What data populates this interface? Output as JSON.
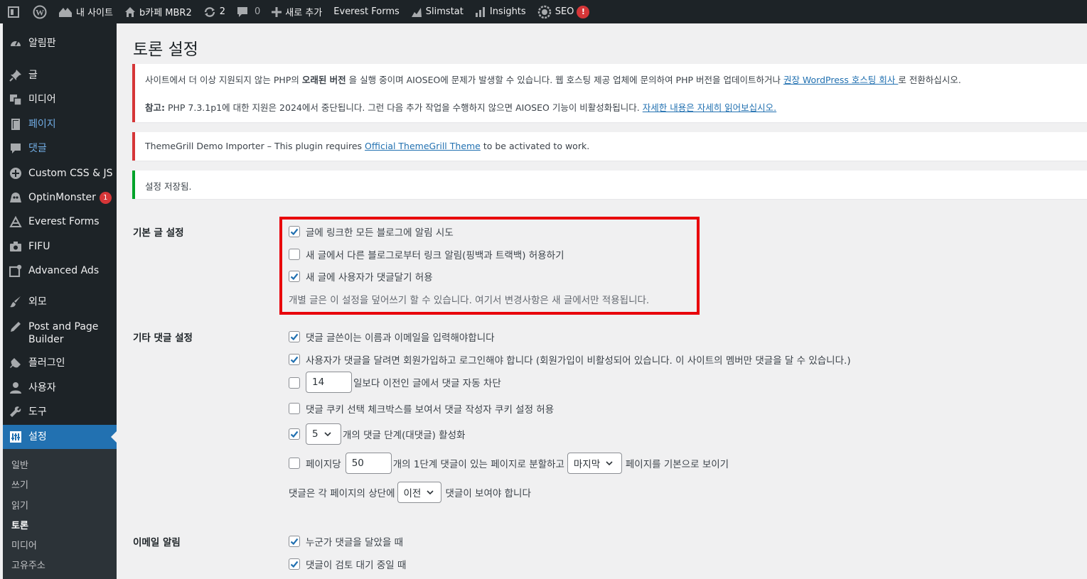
{
  "adminbar": {
    "items": [
      {
        "icon": "wp-logo-icon",
        "label": ""
      },
      {
        "icon": "home-icon",
        "label": "내 사이트"
      },
      {
        "icon": "house-icon",
        "label": "b카페 MBR2"
      },
      {
        "icon": "updates-icon",
        "label": "2"
      },
      {
        "icon": "comment-icon",
        "label": "0"
      },
      {
        "icon": "plus-icon",
        "label": "새로 추가"
      },
      {
        "icon": "",
        "label": "Everest Forms"
      },
      {
        "icon": "chart-icon",
        "label": "Slimstat"
      },
      {
        "icon": "bar-chart-icon",
        "label": "Insights"
      },
      {
        "icon": "seo-gear-icon",
        "label": "SEO",
        "badge": "!"
      }
    ]
  },
  "sidebar": {
    "items": [
      {
        "icon": "dashboard-icon",
        "label": "알림판"
      },
      {
        "icon": "pin-icon",
        "label": "글"
      },
      {
        "icon": "media-icon",
        "label": "미디어"
      },
      {
        "icon": "page-icon",
        "label": "페이지"
      },
      {
        "icon": "comments-icon",
        "label": "댓글"
      },
      {
        "icon": "plus-circle-icon",
        "label": "Custom CSS & JS"
      },
      {
        "icon": "optinmonster-icon",
        "label": "OptinMonster",
        "badge": "1"
      },
      {
        "icon": "forms-icon",
        "label": "Everest Forms"
      },
      {
        "icon": "camera-icon",
        "label": "FIFU"
      },
      {
        "icon": "ads-icon",
        "label": "Advanced Ads"
      },
      {
        "icon": "brush-icon",
        "label": "외모"
      },
      {
        "icon": "pencil-icon",
        "label": "Post and Page Builder"
      },
      {
        "icon": "plugin-icon",
        "label": "플러그인"
      },
      {
        "icon": "user-icon",
        "label": "사용자"
      },
      {
        "icon": "wrench-icon",
        "label": "도구"
      },
      {
        "icon": "settings-icon",
        "label": "설정"
      }
    ],
    "submenu": [
      "일반",
      "쓰기",
      "읽기",
      "토론",
      "미디어",
      "고유주소"
    ]
  },
  "page": {
    "title": "토론 설정"
  },
  "notices": {
    "aioseo_line1_a": "사이트에서 더 이상 지원되지 않는 PHP의 ",
    "aioseo_line1_bold": "오래된 버전",
    "aioseo_line1_b": " 을 실행 중이며 AIOSEO에 문제가 발생할 수 있습니다. 웹 호스팅 제공 업체에 문의하여 PHP 버전을 업데이트하거나 ",
    "aioseo_line1_link": "권장 WordPress 호스팅 회사 ",
    "aioseo_line1_c": "로 전환하십시오.",
    "aioseo_line2_bold": "참고:",
    "aioseo_line2_a": " PHP 7.3.1p1에 대한 지원은 2024에서 중단됩니다. 그런 다음 추가 작업을 수행하지 않으면 AIOSEO 기능이 비활성화됩니다. ",
    "aioseo_line2_link": "자세한 내용은 자세히 읽어보십시오.",
    "themegrill_a": "ThemeGrill Demo Importer",
    "themegrill_b": " – This plugin requires ",
    "themegrill_link": "Official ThemeGrill Theme",
    "themegrill_c": " to be activated to work.",
    "saved": "설정 저장됨."
  },
  "default_post": {
    "label": "기본 글 설정",
    "opt1": {
      "label": "글에 링크한 모든 블로그에 알림 시도",
      "checked": true
    },
    "opt2": {
      "label": "새 글에서 다른 블로그로부터 링크 알림(핑백과 트랙백) 허용하기",
      "checked": false
    },
    "opt3": {
      "label": "새 글에 사용자가 댓글달기 허용",
      "checked": true
    },
    "description": "개별 글은 이 설정을 덮어쓰기 할 수 있습니다. 여기서 변경사항은 새 글에서만 적용됩니다."
  },
  "other_comments": {
    "label": "기타 댓글 설정",
    "opt1": {
      "label": "댓글 글쓴이는 이름과 이메일을 입력해야합니다",
      "checked": true
    },
    "opt2": {
      "label": "사용자가 댓글을 달려면 회원가입하고 로그인해야 합니다 (회원가입이 비활성되어 있습니다. 이 사이트의 멤버만 댓글을 달 수 있습니다.)",
      "checked": true
    },
    "opt3": {
      "days_value": "14",
      "label": "일보다 이전인 글에서 댓글 자동 차단",
      "checked": false
    },
    "opt4": {
      "label": "댓글 쿠키 선택 체크박스를 보여서 댓글 작성자 쿠키 설정 허용",
      "checked": false
    },
    "opt5": {
      "depth_value": "5",
      "label": "개의 댓글 단계(대댓글) 활성화",
      "checked": true
    },
    "opt6": {
      "prefix": "페이지당",
      "per_page_value": "50",
      "middle": "개의 1단계 댓글이 있는 페이지로 분할하고",
      "page_select": "마지막",
      "suffix": "페이지를 기본으로 보이기",
      "checked": false
    },
    "opt7": {
      "prefix": "댓글은 각 페이지의 상단에",
      "order_select": "이전",
      "suffix": "댓글이 보여야 합니다"
    }
  },
  "email": {
    "label": "이메일 알림",
    "opt1": {
      "label": "누군가 댓글을 달았을 때",
      "checked": true
    },
    "opt2": {
      "label": "댓글이 검토 대기 중일 때",
      "checked": true
    }
  },
  "colors": {
    "accent": "#2271b1",
    "admin_dark": "#1d2327",
    "error": "#d63638",
    "success": "#00a32a",
    "highlight": "#e8000b"
  }
}
